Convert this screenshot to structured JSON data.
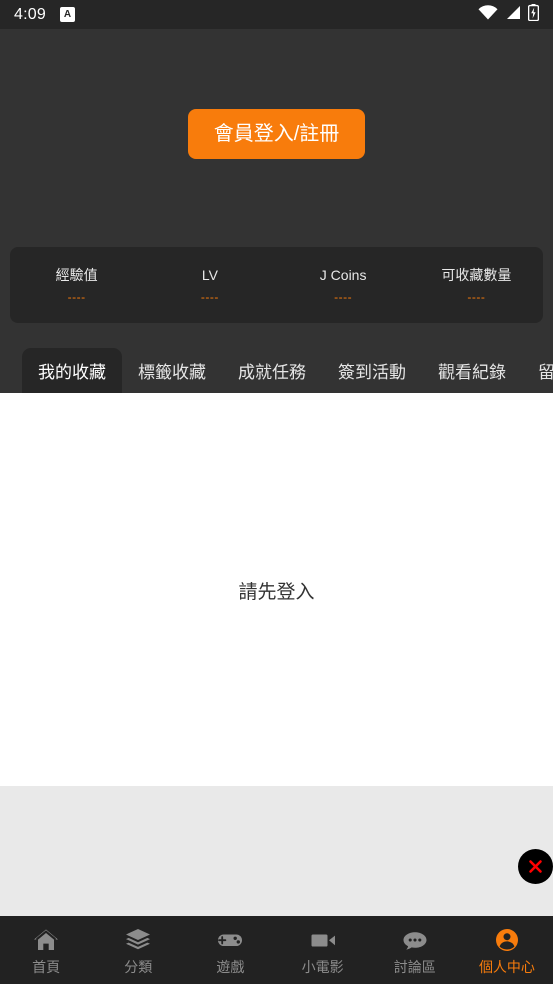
{
  "colors": {
    "background": "#333333",
    "panel": "#262626",
    "accent": "#f87c0c",
    "nav_bg": "#222222",
    "content_bg": "#ffffff",
    "ad_bg": "#e9e9e9",
    "close_x": "#ff0000",
    "inactive_nav": "#8c8c8c"
  },
  "status_bar": {
    "time": "4:09",
    "notification_icon": "app-badge-icon",
    "notification_glyph": "A",
    "wifi_icon": "wifi-icon",
    "signal_icon": "cellular-signal-icon",
    "battery_icon": "battery-charging-icon"
  },
  "header": {
    "login_button_label": "會員登入/註冊"
  },
  "stats": [
    {
      "label": "經驗值",
      "value": "----"
    },
    {
      "label": "LV",
      "value": "----"
    },
    {
      "label": "J Coins",
      "value": "----"
    },
    {
      "label": "可收藏數量",
      "value": "----"
    }
  ],
  "tabs": [
    {
      "label": "我的收藏",
      "active": true
    },
    {
      "label": "標籤收藏",
      "active": false
    },
    {
      "label": "成就任務",
      "active": false
    },
    {
      "label": "簽到活動",
      "active": false
    },
    {
      "label": "觀看紀錄",
      "active": false
    },
    {
      "label": "留言",
      "active": false
    }
  ],
  "content": {
    "empty_message": "請先登入"
  },
  "ad": {
    "close_icon": "close-x-icon"
  },
  "bottom_nav": [
    {
      "label": "首頁",
      "icon": "home-icon",
      "active": false
    },
    {
      "label": "分類",
      "icon": "layers-icon",
      "active": false
    },
    {
      "label": "遊戲",
      "icon": "gamepad-icon",
      "active": false
    },
    {
      "label": "小電影",
      "icon": "video-camera-icon",
      "active": false
    },
    {
      "label": "討論區",
      "icon": "chat-bubble-icon",
      "active": false
    },
    {
      "label": "個人中心",
      "icon": "person-circle-icon",
      "active": true
    }
  ]
}
